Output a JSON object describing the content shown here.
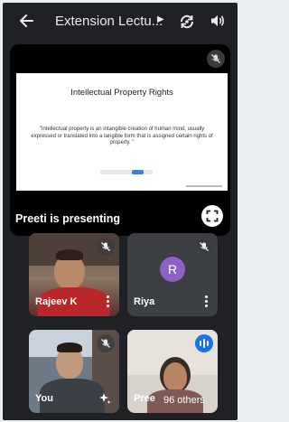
{
  "header": {
    "title": "Extension Lectu..."
  },
  "presentation": {
    "slide_title": "Intellectual Property Rights",
    "slide_body": "\"Intellectual property is an intangible creation of human mind, usually expressed or translated into a tangible form that is assigned certain rights of property. \"",
    "presenter_label": "Preeti is presenting"
  },
  "participants": [
    {
      "name": "Rajeev K",
      "mic": "muted",
      "video": "on"
    },
    {
      "name": "Riya",
      "initial": "R",
      "mic": "muted",
      "video": "off"
    },
    {
      "name": "You",
      "mic": "muted",
      "video": "on"
    },
    {
      "name": "Pree",
      "others": "96 others",
      "mic": "speaking",
      "video": "on"
    }
  ],
  "colors": {
    "background": "#202124",
    "tile": "#3c4043",
    "avatar": "#8e61c8",
    "speaking_indicator": "#1a73e8"
  }
}
